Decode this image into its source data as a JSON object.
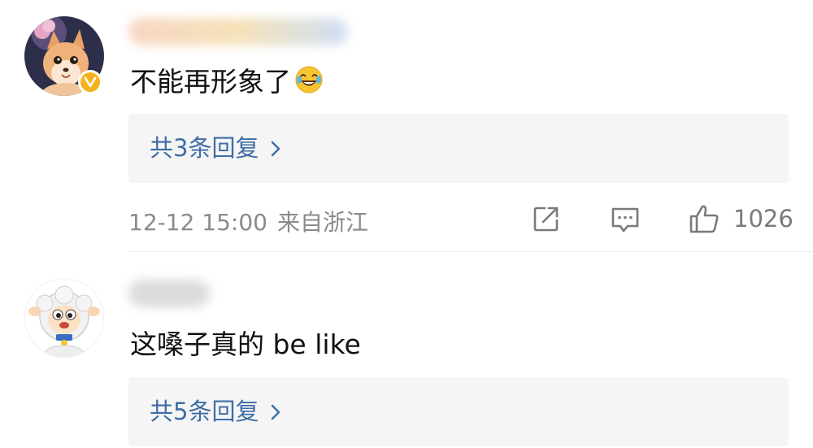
{
  "comments": [
    {
      "text": "不能再形象了",
      "emoji": "laughing-tears-emoji",
      "replies_label": "共3条回复",
      "timestamp": "12-12 15:00",
      "location": "来自浙江",
      "likes": "1026",
      "verified": true,
      "avatar": "fox-avatar"
    },
    {
      "text": "这嗓子真的 be like",
      "replies_label": "共5条回复",
      "avatar": "sheep-avatar"
    }
  ],
  "colors": {
    "link": "#3e6da3",
    "reply_bg": "#f5f5f6",
    "meta": "#8a8a8a",
    "verified_badge": "#f5b21c"
  },
  "icons": [
    "share-icon",
    "comment-icon",
    "like-icon",
    "chevron-right-icon",
    "verified-badge-icon"
  ]
}
